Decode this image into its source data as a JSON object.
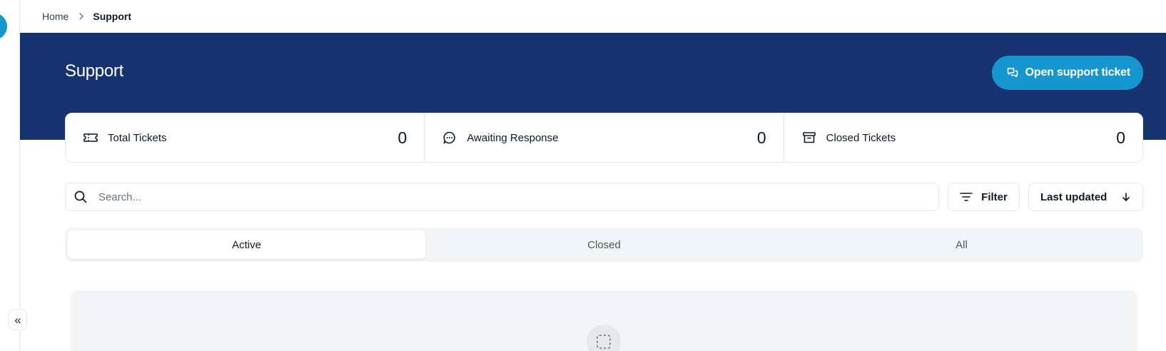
{
  "breadcrumb": {
    "home": "Home",
    "current": "Support"
  },
  "hero": {
    "title": "Support",
    "open_ticket_label": "Open support ticket"
  },
  "stats": [
    {
      "label": "Total Tickets",
      "value": "0",
      "icon": "ticket-icon"
    },
    {
      "label": "Awaiting Response",
      "value": "0",
      "icon": "chat-bubble-icon"
    },
    {
      "label": "Closed Tickets",
      "value": "0",
      "icon": "archive-icon"
    }
  ],
  "search": {
    "placeholder": "Search..."
  },
  "toolbar": {
    "filter_label": "Filter",
    "sort_label": "Last updated"
  },
  "tabs": [
    {
      "label": "Active",
      "active": true
    },
    {
      "label": "Closed",
      "active": false
    },
    {
      "label": "All",
      "active": false
    }
  ],
  "colors": {
    "hero_bg": "#163370",
    "accent": "#1596cf"
  }
}
